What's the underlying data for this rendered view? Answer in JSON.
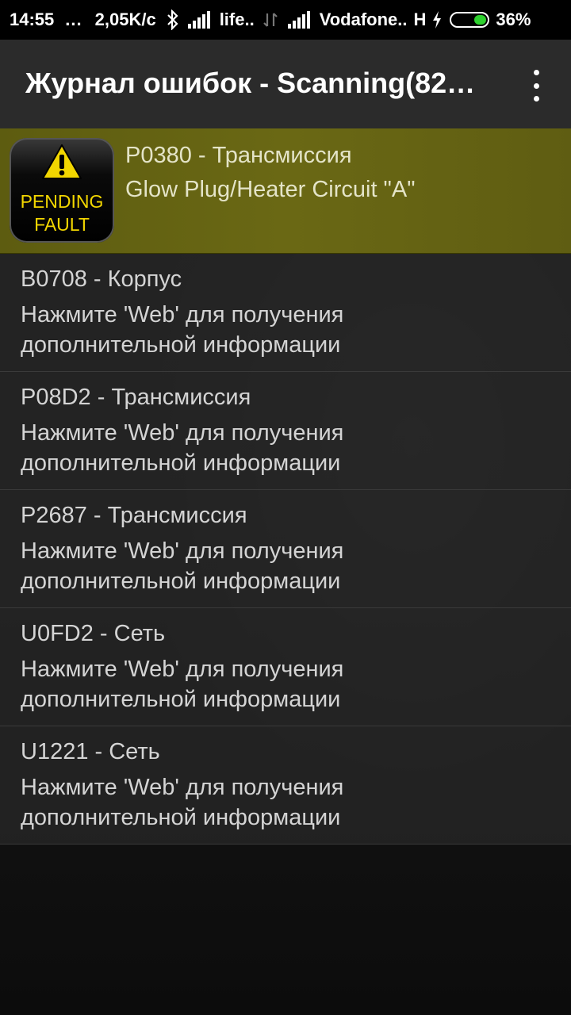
{
  "status_bar": {
    "time": "14:55",
    "dots": "...",
    "speed": "2,05K/c",
    "carrier1": "life..",
    "carrier2": "Vodafone..",
    "network_type": "H",
    "battery_percent": "36%",
    "battery_level": 0.36,
    "battery_color": "#2ed12e"
  },
  "app_bar": {
    "title": "Журнал ошибок - Scanning(82…"
  },
  "badge": {
    "line1": "PENDING",
    "line2": "FAULT",
    "icon": "warning-triangle-icon",
    "color": "#f2d600"
  },
  "faults": [
    {
      "code": "P0380 - Трансмиссия",
      "description": "Glow Plug/Heater Circuit \"A\"",
      "pending": true
    },
    {
      "code": "B0708 - Корпус",
      "description": "Нажмите 'Web' для получения дополнительной информации",
      "pending": false
    },
    {
      "code": "P08D2 - Трансмиссия",
      "description": "Нажмите 'Web' для получения дополнительной информации",
      "pending": false
    },
    {
      "code": "P2687 - Трансмиссия",
      "description": "Нажмите 'Web' для получения дополнительной информации",
      "pending": false
    },
    {
      "code": "U0FD2 - Сеть",
      "description": "Нажмите 'Web' для получения дополнительной информации",
      "pending": false
    },
    {
      "code": "U1221 - Сеть",
      "description": "Нажмите 'Web' для получения дополнительной информации",
      "pending": false
    }
  ],
  "colors": {
    "highlight": "#666412",
    "app_bar": "#2b2b2b",
    "status_bar": "#000000"
  }
}
